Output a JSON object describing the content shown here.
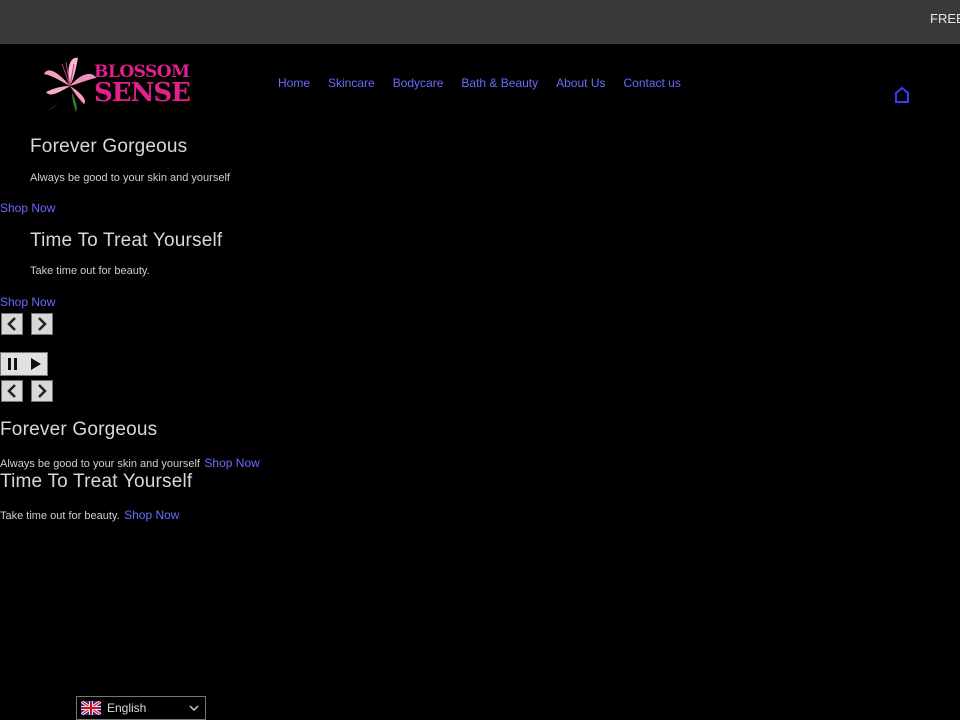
{
  "topbar": {
    "announcement": "FREE"
  },
  "logo": {
    "line1": "BLOSSOM",
    "line2": "SENSE"
  },
  "nav": {
    "items": [
      {
        "label": "Home"
      },
      {
        "label": "Skincare"
      },
      {
        "label": "Bodycare"
      },
      {
        "label": "Bath & Beauty"
      },
      {
        "label": "About Us"
      },
      {
        "label": "Contact us"
      }
    ]
  },
  "slides": [
    {
      "title": "Forever Gorgeous",
      "subtitle": "Always be good to your skin and yourself",
      "cta": "Shop Now"
    },
    {
      "title": "Time To Treat Yourself",
      "subtitle": "Take time out for beauty.",
      "cta": "Shop Now"
    }
  ],
  "language": {
    "selected": "English"
  },
  "colors": {
    "accent": "#6a6aff",
    "brand": "#e0208c",
    "topbar": "#3a3a3a"
  }
}
